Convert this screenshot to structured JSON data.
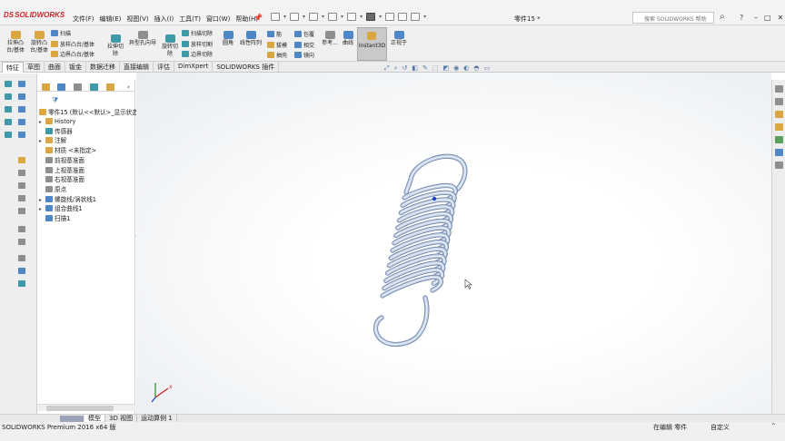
{
  "app": {
    "logo": "SOLIDWORKS",
    "document_title": "零件15 *"
  },
  "menu": [
    "文件(F)",
    "编辑(E)",
    "视图(V)",
    "插入(I)",
    "工具(T)",
    "窗口(W)",
    "帮助(H)"
  ],
  "search": {
    "placeholder": "搜索 SOLIDWORKS 帮助"
  },
  "ribbon": {
    "extrude_boss": "拉伸凸\n台/基体",
    "revolve_boss": "旋转凸\n台/基体",
    "sweep": "扫描",
    "loft_boss": "放样凸台/基体",
    "boundary_boss": "边界凸台/基体",
    "extrude_cut": "拉伸切\n除",
    "hole_wizard": "异型孔向导",
    "revolve_cut": "旋转切\n除",
    "sweep_cut": "扫描切除",
    "loft_cut": "放样切割",
    "boundary_cut": "边界切除",
    "fillet": "圆角",
    "linear_pattern": "线性阵列",
    "rib": "筋",
    "wrap": "包覆",
    "draft": "拔模",
    "intersect": "相交",
    "shell": "抽壳",
    "mirror": "镜向",
    "reference": "参考...",
    "curves": "曲线",
    "instant3d": "Instant3D",
    "normal_to": "正视于"
  },
  "tabs": [
    "特征",
    "草图",
    "曲面",
    "钣金",
    "数据迁移",
    "直接编辑",
    "评估",
    "DimXpert",
    "SOLIDWORKS 插件"
  ],
  "tree": {
    "root": "零件15 (默认<<默认>_显示状态",
    "items": [
      {
        "label": "History",
        "expand": "▸"
      },
      {
        "label": "传感器",
        "expand": ""
      },
      {
        "label": "注解",
        "expand": "▸"
      },
      {
        "label": "材质 <未指定>",
        "expand": ""
      },
      {
        "label": "前视基准面",
        "expand": ""
      },
      {
        "label": "上视基准面",
        "expand": ""
      },
      {
        "label": "右视基准面",
        "expand": ""
      },
      {
        "label": "原点",
        "expand": ""
      },
      {
        "label": "螺旋线/涡状线1",
        "expand": "▸"
      },
      {
        "label": "组合曲线1",
        "expand": "▸"
      },
      {
        "label": "扫描1",
        "expand": ""
      }
    ]
  },
  "bottom_tabs": [
    "模型",
    "3D 视图",
    "运动算例 1"
  ],
  "status": {
    "product": "SOLIDWORKS Premium 2016 x64 版",
    "editing": "在编辑 零件",
    "units": "自定义"
  },
  "colors": {
    "spring": "#c6d3e6",
    "spring_edge": "#6f86ad",
    "accent_red": "#d2232a"
  }
}
